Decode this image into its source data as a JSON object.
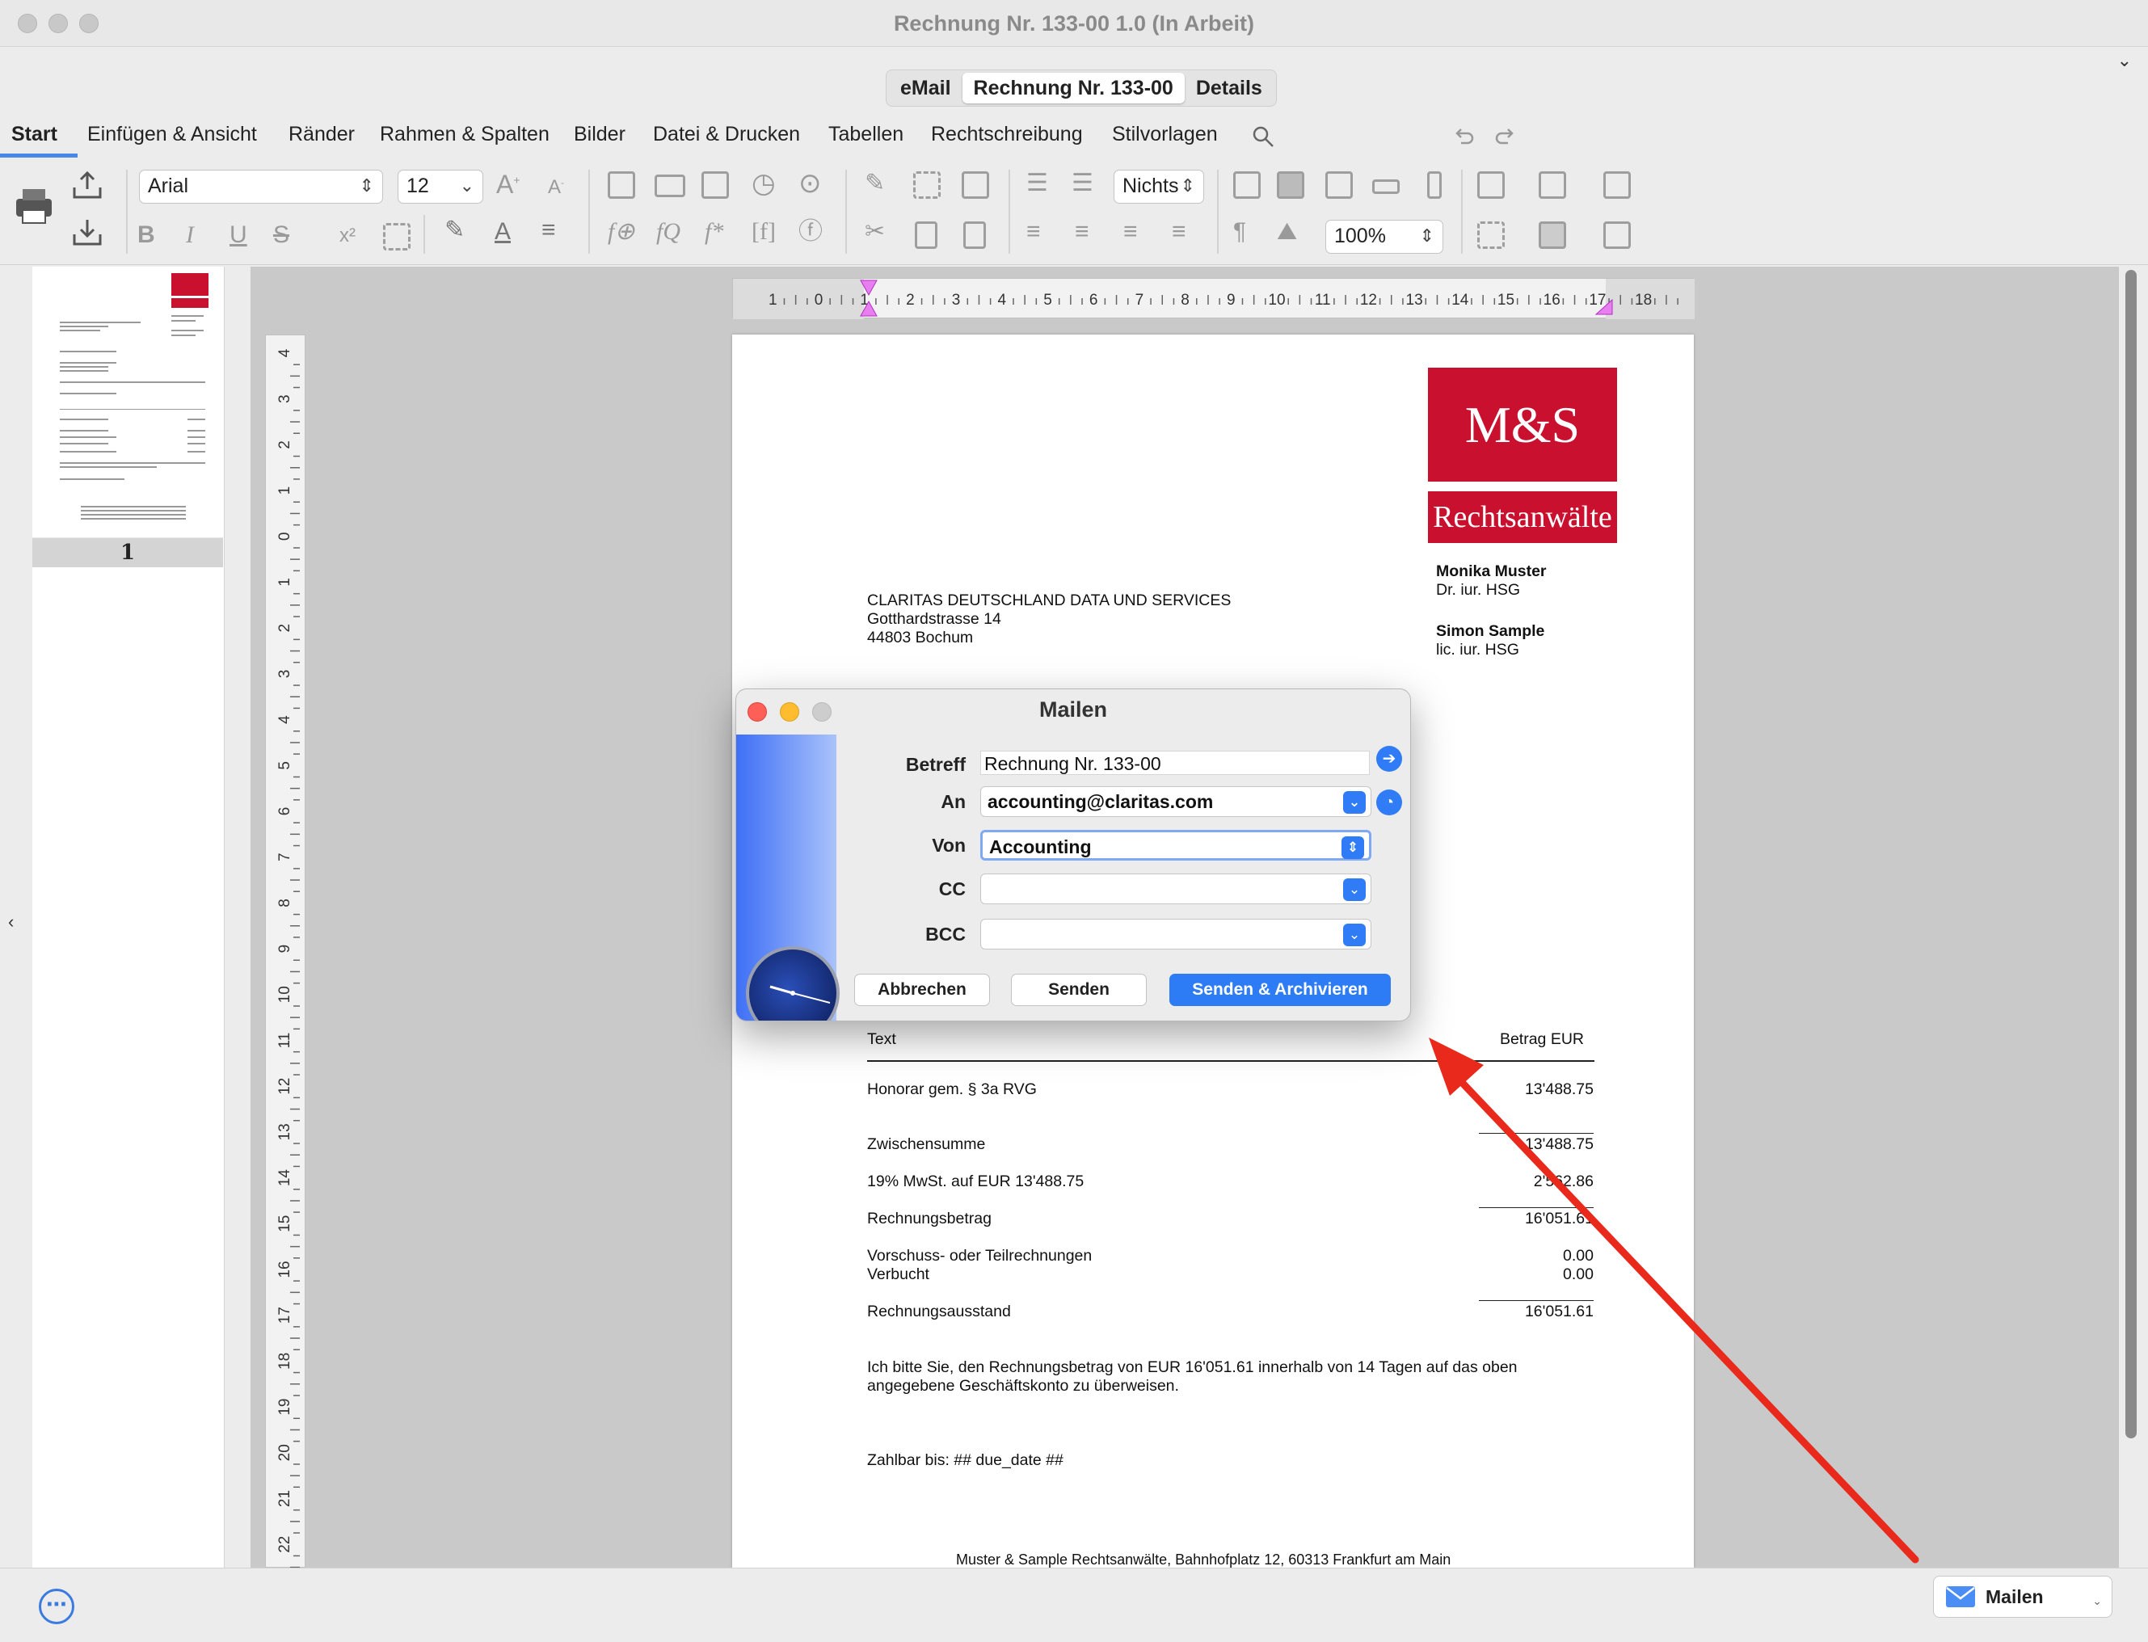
{
  "window": {
    "title": "Rechnung Nr. 133-00 1.0 (In Arbeit)"
  },
  "segments": [
    {
      "label": "eMail",
      "active": false
    },
    {
      "label": "Rechnung Nr. 133-00",
      "active": true
    },
    {
      "label": "Details",
      "active": false
    }
  ],
  "menu": [
    "Start",
    "Einfügen & Ansicht",
    "Ränder",
    "Rahmen & Spalten",
    "Bilder",
    "Datei & Drucken",
    "Tabellen",
    "Rechtschreibung",
    "Stilvorlagen"
  ],
  "toolbar": {
    "font": "Arial",
    "size": "12",
    "style": "Nichts",
    "zoom": "100%"
  },
  "thumbnail": {
    "page_number": "1"
  },
  "ruler": {
    "h_ticks": [
      "1",
      "0",
      "1",
      "2",
      "3",
      "4",
      "5",
      "6",
      "7",
      "8",
      "9",
      "10",
      "11",
      "12",
      "13",
      "14",
      "15",
      "16",
      "17",
      "18"
    ],
    "v_ticks": [
      "4",
      "3",
      "2",
      "1",
      "0",
      "1",
      "2",
      "3",
      "4",
      "5",
      "6",
      "7",
      "8",
      "9",
      "10",
      "11",
      "12",
      "13",
      "14",
      "15",
      "16",
      "17",
      "18",
      "19",
      "20",
      "21",
      "22"
    ]
  },
  "document": {
    "logo": {
      "main": "M&S",
      "sub": "Rechtsanwälte"
    },
    "partners": [
      {
        "name": "Monika Muster",
        "title": "Dr. iur. HSG"
      },
      {
        "name": "Simon Sample",
        "title": "lic. iur. HSG"
      }
    ],
    "address": [
      "CLARITAS DEUTSCHLAND DATA UND SERVICES",
      "Gotthardstrasse 14",
      "44803 Bochum"
    ],
    "table_header": {
      "text": "Text",
      "amount": "Betrag EUR"
    },
    "rows": [
      {
        "label": "Honorar gem. § 3a RVG",
        "value": "13'488.75"
      },
      {
        "label": "Zwischensumme",
        "value": "13'488.75"
      },
      {
        "label": "19% MwSt. auf EUR 13'488.75",
        "value": "2'562.86"
      },
      {
        "label": "Rechnungsbetrag",
        "value": "16'051.61"
      },
      {
        "label": "Vorschuss- oder Teilrechnungen",
        "value": "0.00"
      },
      {
        "label": "Verbucht",
        "value": "0.00"
      },
      {
        "label": "Rechnungsausstand",
        "value": "16'051.61"
      }
    ],
    "closing": [
      "Ich bitte Sie, den Rechnungsbetrag von EUR 16'051.61 innerhalb von 14 Tagen auf das oben",
      "angegebene Geschäftskonto zu überweisen."
    ],
    "due": "Zahlbar bis: ## due_date ##",
    "footer": "Muster & Sample Rechtsanwälte, Bahnhofplatz 12, 60313 Frankfurt am Main"
  },
  "dialog": {
    "title": "Mailen",
    "labels": {
      "subject": "Betreff",
      "to": "An",
      "from": "Von",
      "cc": "CC",
      "bcc": "BCC"
    },
    "values": {
      "subject": "Rechnung Nr. 133-00",
      "to": "accounting@claritas.com",
      "from": "Accounting",
      "cc": "",
      "bcc": ""
    },
    "buttons": {
      "cancel": "Abbrechen",
      "send": "Senden",
      "send_archive": "Senden & Archivieren"
    }
  },
  "bottom": {
    "mail_button": "Mailen"
  },
  "colors": {
    "accent": "#2d7bf5",
    "brand": "#c9102e",
    "annotation_arrow": "#e8291c"
  }
}
